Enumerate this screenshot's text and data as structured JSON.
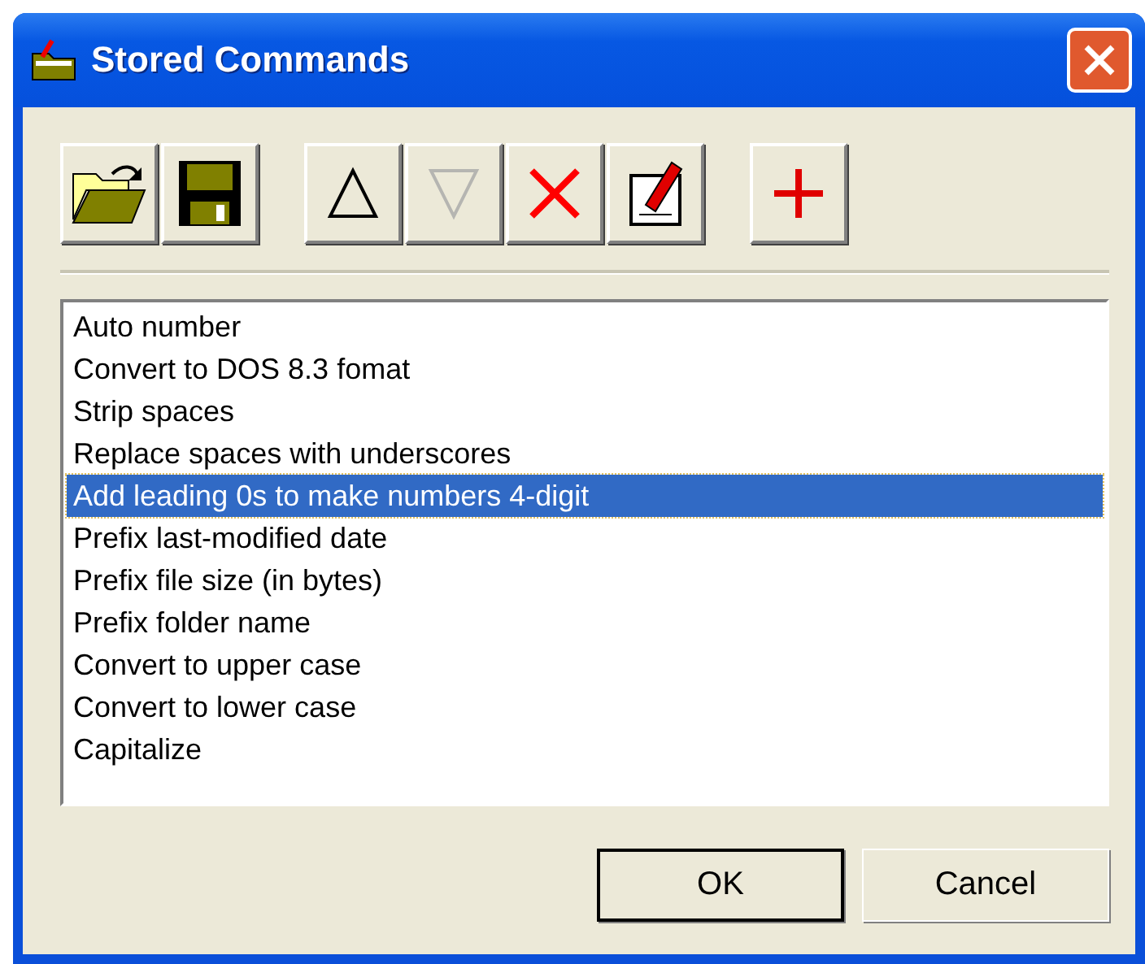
{
  "window": {
    "title": "Stored Commands"
  },
  "toolbar": {
    "groups": [
      {
        "buttons": [
          {
            "kind": "open",
            "disabled": false
          },
          {
            "kind": "save",
            "disabled": false
          }
        ]
      },
      {
        "buttons": [
          {
            "kind": "up",
            "disabled": false
          },
          {
            "kind": "down",
            "disabled": true
          },
          {
            "kind": "delete",
            "disabled": false
          },
          {
            "kind": "edit",
            "disabled": false
          }
        ]
      },
      {
        "buttons": [
          {
            "kind": "add",
            "disabled": false
          }
        ]
      }
    ]
  },
  "list": {
    "items": [
      {
        "label": "Auto number",
        "selected": false
      },
      {
        "label": "Convert to DOS 8.3 fomat",
        "selected": false
      },
      {
        "label": "Strip spaces",
        "selected": false
      },
      {
        "label": "Replace spaces with underscores",
        "selected": false
      },
      {
        "label": "Add leading 0s to make numbers 4-digit",
        "selected": true
      },
      {
        "label": "Prefix last-modified date",
        "selected": false
      },
      {
        "label": "Prefix file size (in bytes)",
        "selected": false
      },
      {
        "label": "Prefix folder name",
        "selected": false
      },
      {
        "label": "Convert to upper case",
        "selected": false
      },
      {
        "label": "Convert to lower case",
        "selected": false
      },
      {
        "label": "Capitalize",
        "selected": false
      }
    ]
  },
  "buttons": [
    {
      "label": "OK",
      "default": true
    },
    {
      "label": "Cancel",
      "default": false
    }
  ]
}
